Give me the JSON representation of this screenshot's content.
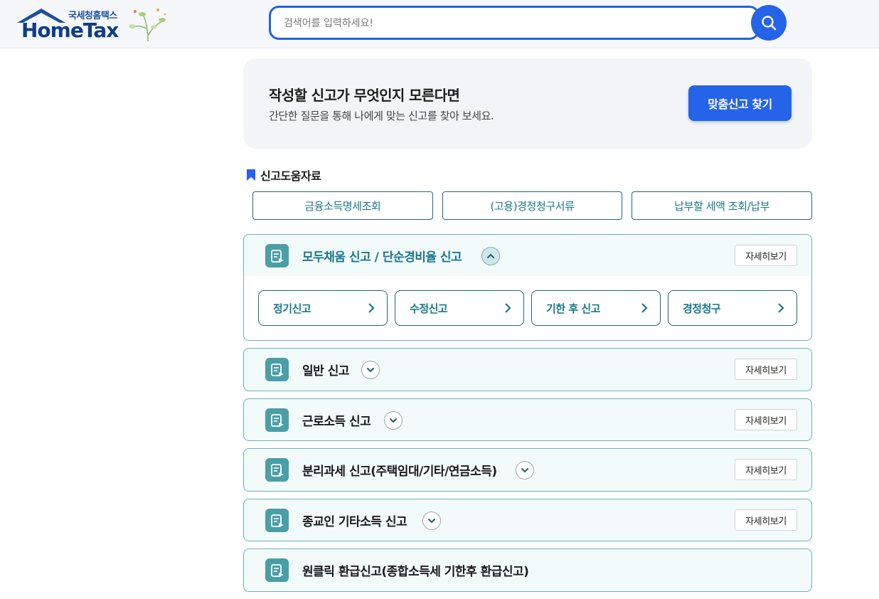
{
  "header": {
    "logo_sub": "국세청홈택스",
    "logo_main": "HomeTax",
    "search_placeholder": "검색어를 입력하세요!"
  },
  "banner": {
    "title": "작성할 신고가 무엇인지 모른다면",
    "subtitle": "간단한 질문을 통해 나에게 맞는 신고를 찾아 보세요.",
    "cta_label": "맞춤신고 찾기"
  },
  "help": {
    "title": "신고도움자료",
    "links": [
      "금융소득명세조회",
      "(고용)경정청구서류",
      "납부할 세액 조회/납부"
    ]
  },
  "accordions": [
    {
      "label": "모두채움 신고 / 단순경비율 신고",
      "more": "자세히보기",
      "expanded": true,
      "sub_items": [
        "정기신고",
        "수정신고",
        "기한 후 신고",
        "경정청구"
      ]
    },
    {
      "label": "일반 신고",
      "more": "자세히보기",
      "expanded": false
    },
    {
      "label": "근로소득 신고",
      "more": "자세히보기",
      "expanded": false
    },
    {
      "label": "분리과세 신고(주택임대/기타/연금소득)",
      "more": "자세히보기",
      "expanded": false
    },
    {
      "label": "종교인 기타소득 신고",
      "more": "자세히보기",
      "expanded": false
    },
    {
      "label": "원클릭 환급신고(종합소득세 기한후 환급신고)",
      "expanded": false
    }
  ],
  "colors": {
    "primary": "#2563e9",
    "teal": "#18788c",
    "accordion_border": "#69b3b8",
    "accordion_bg": "#f2fafa"
  }
}
